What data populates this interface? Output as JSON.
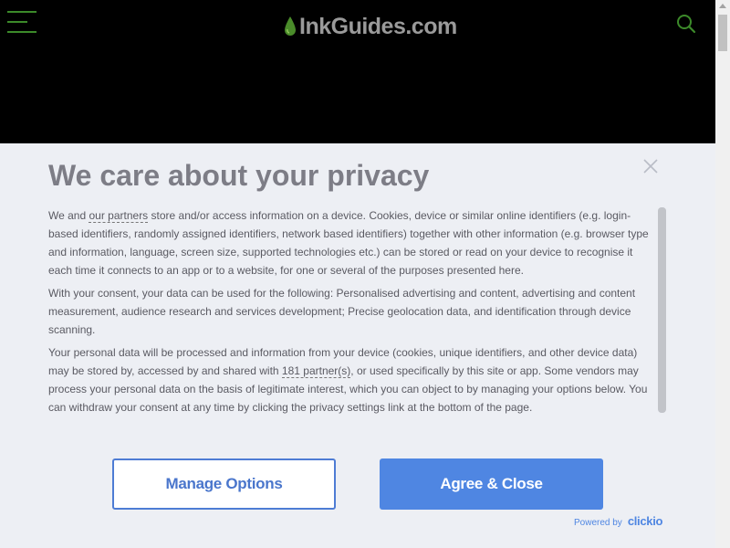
{
  "site": {
    "logo_text": "InkGuides.com"
  },
  "consent": {
    "title": "We care about your privacy",
    "para1_pre": "We and ",
    "para1_link": "our partners",
    "para1_post": " store and/or access information on a device. Cookies, device or similar online identifiers (e.g. login-based identifiers, randomly assigned identifiers, network based identifiers) together with other information (e.g. browser type and information, language, screen size, supported technologies etc.) can be stored or read on your device to recognise it each time it connects to an app or to a website, for one or several of the purposes presented here.",
    "para2": "With your consent, your data can be used for the following: Personalised advertising and content, advertising and content measurement, audience research and services development; Precise geolocation data, and identification through device scanning.",
    "para3_pre": "Your personal data will be processed and information from your device (cookies, unique identifiers, and other device data) may be stored by, accessed by and shared with ",
    "para3_link": "181 partner(s)",
    "para3_post": ", or used specifically by this site or app. Some vendors may process your personal data on the basis of legitimate interest, which you can object to by managing your options below. You can withdraw your consent at any time by clicking the privacy settings link at the bottom of the page.",
    "manage_label": "Manage Options",
    "agree_label": "Agree & Close",
    "powered_label": "Powered by",
    "powered_brand": "clickio"
  },
  "icons": {
    "menu": "hamburger-icon",
    "search": "search-icon",
    "close": "close-icon",
    "logo": "ink-drop-icon"
  },
  "colors": {
    "brand_green": "#3c8a2a",
    "accent_blue": "#4f86e2",
    "dialog_bg": "#edeff4",
    "header_bg": "#000000"
  }
}
